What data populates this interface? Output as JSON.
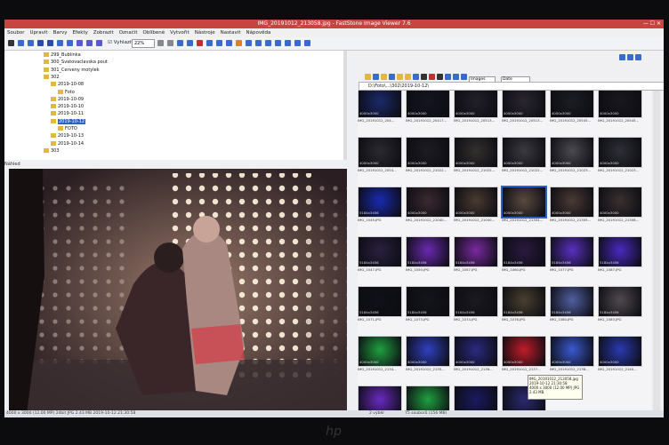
{
  "window": {
    "title": "IMG_20191012_213058.jpg - FastStone Image Viewer 7.6",
    "controls": "— ☐ ✕"
  },
  "menu": [
    "Soubor",
    "Upravit",
    "Barvy",
    "Efekty",
    "Zobrazit",
    "Označit",
    "Oblíbené",
    "Vytvořit",
    "Nástroje",
    "Nastavit",
    "Nápověda"
  ],
  "toolbar": {
    "fit_label": "Vyhlazit",
    "zoom": "22%"
  },
  "tree": {
    "items": [
      {
        "label": "299_Bublinka",
        "level": 1
      },
      {
        "label": "300_Svatovaclavska pout",
        "level": 1
      },
      {
        "label": "301_Cerveny motylek",
        "level": 1
      },
      {
        "label": "302",
        "level": 1
      },
      {
        "label": "2019-10-08",
        "level": 2
      },
      {
        "label": "Foto",
        "level": 3
      },
      {
        "label": "2019-10-09",
        "level": 2
      },
      {
        "label": "2019-10-10",
        "level": 2
      },
      {
        "label": "2019-10-11",
        "level": 2
      },
      {
        "label": "2019-10-12",
        "level": 2,
        "selected": true
      },
      {
        "label": "FOTO",
        "level": 3
      },
      {
        "label": "2019-10-13",
        "level": 2
      },
      {
        "label": "2019-10-14",
        "level": 2
      },
      {
        "label": "303",
        "level": 1
      }
    ]
  },
  "preview_label": "Náhled",
  "status": {
    "left": "4000 x 3000 (12.00 MP)  24bit  JPG  2.43 MB   2019-10-12 21:30:58",
    "filename": "IMG_20191012_213058.jpg [ 51 / 75 ]",
    "center": "2 výběr",
    "right": "75 souborů (156 MB)"
  },
  "right_panel": {
    "path": "D:\\Foto\\...\\302\\2019-10-12\\",
    "filter": "Images",
    "sort": "Date"
  },
  "thumbnails": [
    {
      "cap": "IMG_20191012_204...",
      "dims": "4000x3000",
      "color": "#1a2a6a"
    },
    {
      "cap": "IMG_20191012_20417...",
      "dims": "4000x3000",
      "color": "#151520"
    },
    {
      "cap": "IMG_20191012_20513...",
      "dims": "4000x3000",
      "color": "#22202a"
    },
    {
      "cap": "IMG_20191012_20513...",
      "dims": "4000x3000",
      "color": "#2a2630"
    },
    {
      "cap": "IMG_20191012_20545...",
      "dims": "4000x3000",
      "color": "#1c1c24"
    },
    {
      "cap": "IMG_20191012_20545...",
      "dims": "4000x3000",
      "color": "#18181e"
    },
    {
      "cap": "IMG_20191012_2054...",
      "dims": "4000x3000",
      "color": "#2a2a30"
    },
    {
      "cap": "IMG_20191012_21022...",
      "dims": "4000x3000",
      "color": "#1c1c22"
    },
    {
      "cap": "IMG_20191012_21022...",
      "dims": "4000x3000",
      "color": "#33302e"
    },
    {
      "cap": "IMG_20191012_21022...",
      "dims": "4000x3000",
      "color": "#3a3a40"
    },
    {
      "cap": "IMG_20191012_21023...",
      "dims": "4000x3000",
      "color": "#4a4a50"
    },
    {
      "cap": "IMG_20191012_21023...",
      "dims": "4000x3000",
      "color": "#2e2e36"
    },
    {
      "cap": "IMG_1045.JPG",
      "dims": "5184x3456",
      "color": "#1a2ab0"
    },
    {
      "cap": "IMG_20191012_21040...",
      "dims": "4000x3000",
      "color": "#3a2a30"
    },
    {
      "cap": "IMG_20191012_21040...",
      "dims": "4000x3000",
      "color": "#4a3a30"
    },
    {
      "cap": "IMG_20191012_21304...",
      "dims": "4000x3000",
      "color": "#5a4a40"
    },
    {
      "cap": "IMG_20191012_21305...",
      "dims": "4000x3000",
      "color": "#4a3a34"
    },
    {
      "cap": "IMG_20191012_21308...",
      "dims": "4000x3000",
      "color": "#3a3030"
    },
    {
      "cap": "IMG_1047.JPG",
      "dims": "5184x3456",
      "color": "#2a2040"
    },
    {
      "cap": "IMG_1050.JPG",
      "dims": "5184x3456",
      "color": "#6a2ab0"
    },
    {
      "cap": "IMG_1057.JPG",
      "dims": "5184x3456",
      "color": "#7a2aa0"
    },
    {
      "cap": "IMG_1060.JPG",
      "dims": "5184x3456",
      "color": "#2a1a40"
    },
    {
      "cap": "IMG_1077.JPG",
      "dims": "5184x3456",
      "color": "#5a30c0"
    },
    {
      "cap": "IMG_1087.JPG",
      "dims": "5184x3456",
      "color": "#4a2ac0"
    },
    {
      "cap": "IMG_1071.JPG",
      "dims": "5184x3456",
      "color": "#101018"
    },
    {
      "cap": "IMG_1073.JPG",
      "dims": "5184x3456",
      "color": "#14141c"
    },
    {
      "cap": "IMG_1074.JPG",
      "dims": "5184x3456",
      "color": "#1a1a20"
    },
    {
      "cap": "IMG_1076.JPG",
      "dims": "5184x3456",
      "color": "#4a4030"
    },
    {
      "cap": "IMG_1080.JPG",
      "dims": "5184x3456",
      "color": "#5060a0"
    },
    {
      "cap": "IMG_1083.JPG",
      "dims": "5184x3456",
      "color": "#504a50"
    },
    {
      "cap": "IMG_20191012_2134...",
      "dims": "4000x3000",
      "color": "#20a040"
    },
    {
      "cap": "IMG_20191012_2135...",
      "dims": "4000x3000",
      "color": "#3040c0"
    },
    {
      "cap": "IMG_20191012_2136...",
      "dims": "4000x3000",
      "color": "#2a2a80"
    },
    {
      "cap": "IMG_20191012_2137...",
      "dims": "4000x3000",
      "color": "#c01c2a"
    },
    {
      "cap": "IMG_20191012_2138...",
      "dims": "4000x3000",
      "color": "#3a5ad0"
    },
    {
      "cap": "IMG_20191012_2140...",
      "dims": "4000x3000",
      "color": "#2a3ab0"
    },
    {
      "cap": "IMG_20191012_2141...",
      "dims": "4000x3000",
      "color": "#6a2ac0"
    },
    {
      "cap": "IMG_20191012_2142...",
      "dims": "4000x3000",
      "color": "#20a040"
    },
    {
      "cap": "IMG_20191012_2143...",
      "dims": "4000x3000",
      "color": "#1a1a60"
    },
    {
      "cap": "IMG_20191012_2144...",
      "dims": "4000x3000",
      "color": "#2a2a70"
    }
  ],
  "tooltip": [
    "IMG_20191012_213058.jpg",
    "2019-10-12 21:30:58",
    "4000 x 3000 (12.00 MP) JPG",
    "2.43 MB"
  ],
  "bezel": {
    "logo": "hp"
  },
  "colors": {
    "title": "#c8453f",
    "selection": "#2a62c9",
    "folder": "#e2b83d"
  }
}
